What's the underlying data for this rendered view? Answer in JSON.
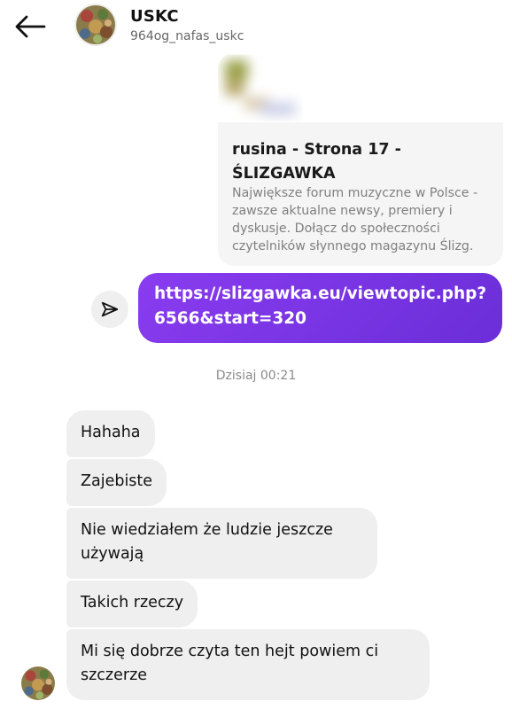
{
  "header": {
    "title": "USKC",
    "handle": "964og_nafas_uskc"
  },
  "link_preview": {
    "title": "rusina - Strona 17 - ŚLIZGAWKA",
    "description": "Największe forum muzyczne w Polsce - zawsze aktualne newsy, premiery i dyskusje. Dołącz do społeczności czytelników słynnego magazynu Ślizg."
  },
  "outgoing_message": {
    "text": "https://slizgawka.eu/viewtopic.php?\n6566&start=320"
  },
  "timestamp": "Dzisiaj 00:21",
  "incoming_messages": [
    "Hahaha",
    "Zajebiste",
    "Nie wiedziałem że ludzie jeszcze używają",
    "Takich rzeczy",
    "Mi się dobrze czyta ten hejt powiem ci szczerze"
  ],
  "icons": {
    "back": "arrow-left-icon",
    "share": "send-icon",
    "avatar": "profile-avatar"
  },
  "colors": {
    "outgoing_bubble": "#7b35e6",
    "incoming_bubble": "#efefef",
    "background": "#ffffff"
  }
}
